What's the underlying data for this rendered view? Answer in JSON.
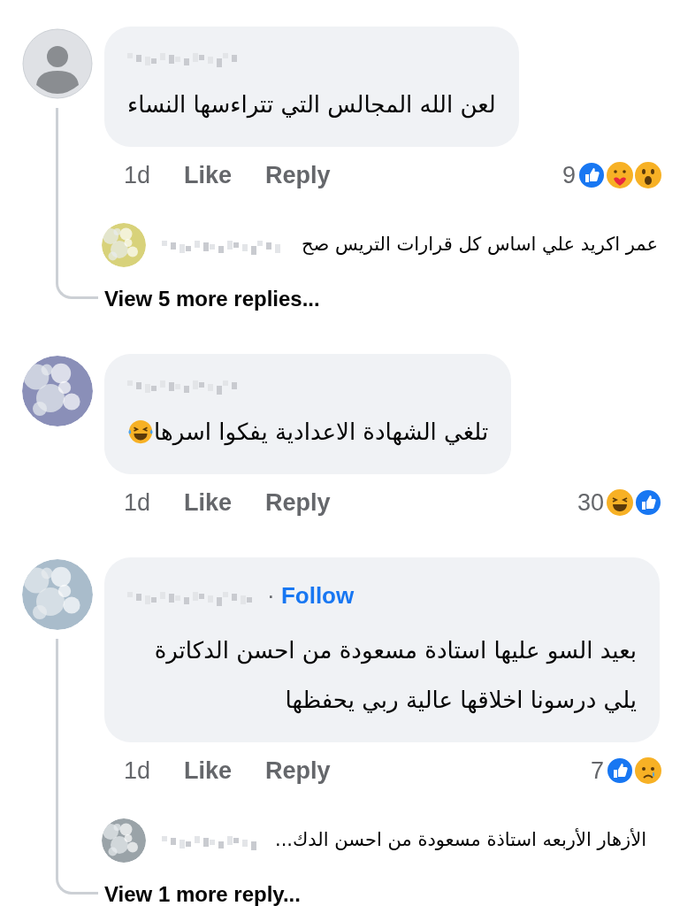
{
  "comments": [
    {
      "avatar": {
        "kind": "default"
      },
      "text": "لعن الله المجالس التي تتراءسها النساء",
      "time": "1d",
      "like": "Like",
      "reply": "Reply",
      "reaction_count": "9",
      "reactions": [
        {
          "kind": "like"
        },
        {
          "kind": "care"
        },
        {
          "kind": "wow"
        }
      ],
      "reply_preview": {
        "avatar": {
          "kind": "picture"
        },
        "text": "عمر اكريد علي اساس كل قرارات التريس صح"
      },
      "view_more": "View 5 more replies..."
    },
    {
      "avatar": {
        "kind": "picture"
      },
      "text": "تلغي الشهادة الاعدادية يفكوا اسرها",
      "emoji": {
        "kind": "tears_of_joy"
      },
      "time": "1d",
      "like": "Like",
      "reply": "Reply",
      "reaction_count": "30",
      "reactions": [
        {
          "kind": "haha"
        },
        {
          "kind": "like"
        }
      ]
    },
    {
      "avatar": {
        "kind": "picture"
      },
      "follow": {
        "separator": "·",
        "label": "Follow"
      },
      "text": "بعيد السو عليها استادة مسعودة من احسن الدكاترة يلي درسونا اخلاقها عالية ربي يحفظها",
      "time": "1d",
      "like": "Like",
      "reply": "Reply",
      "reaction_count": "7",
      "reactions": [
        {
          "kind": "like"
        },
        {
          "kind": "sad"
        }
      ],
      "reply_preview": {
        "avatar": {
          "kind": "picture"
        },
        "text": "الأزهار الأربعه استاذة مسعودة من احسن الدك..."
      },
      "view_more": "View 1 more reply..."
    }
  ]
}
